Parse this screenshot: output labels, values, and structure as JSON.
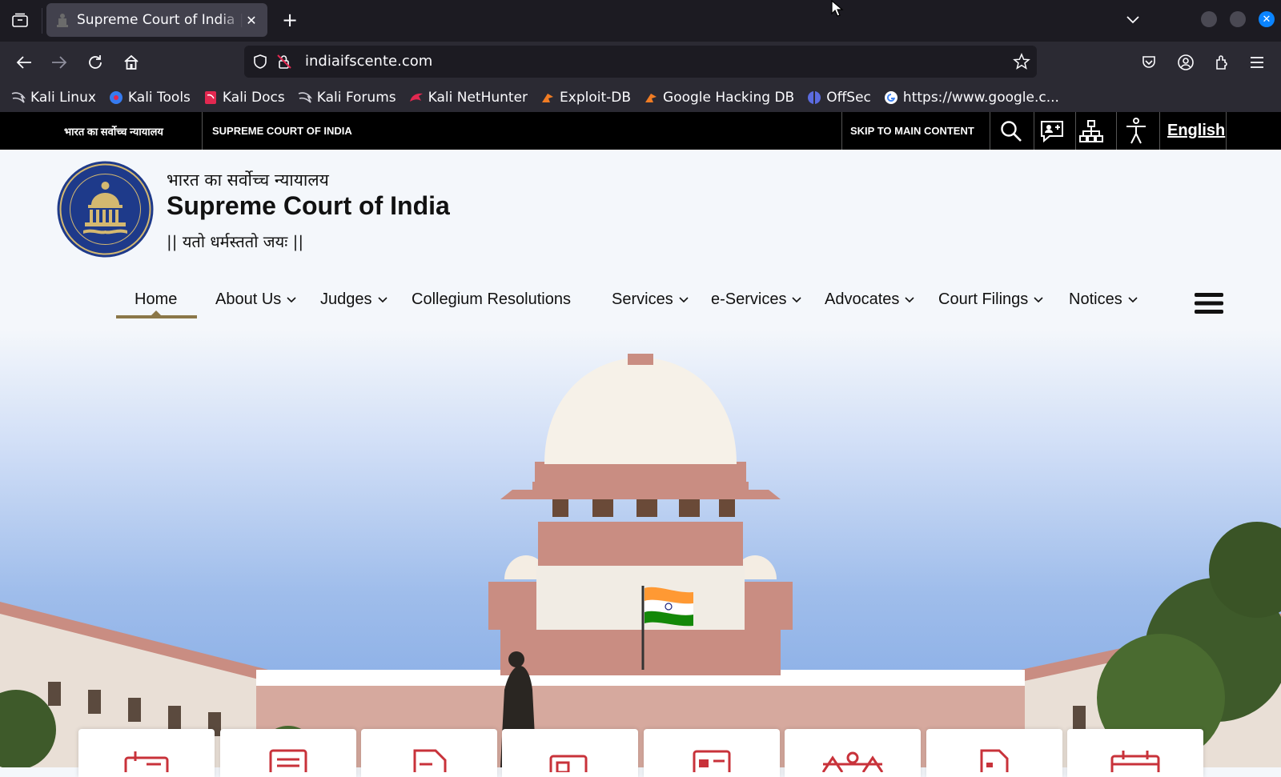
{
  "browser": {
    "tab_title": "Supreme Court of India | I",
    "url": "indiaifscente.com",
    "bookmarks": [
      {
        "label": "Kali Linux",
        "icon": "kali-dragon-icon"
      },
      {
        "label": "Kali Tools",
        "icon": "kali-tools-icon"
      },
      {
        "label": "Kali Docs",
        "icon": "kali-docs-icon"
      },
      {
        "label": "Kali Forums",
        "icon": "kali-dragon-icon"
      },
      {
        "label": "Kali NetHunter",
        "icon": "nethunter-icon"
      },
      {
        "label": "Exploit-DB",
        "icon": "exploit-db-icon"
      },
      {
        "label": "Google Hacking DB",
        "icon": "ghdb-icon"
      },
      {
        "label": "OffSec",
        "icon": "offsec-icon"
      },
      {
        "label": "https://www.google.c...",
        "icon": "google-icon"
      }
    ]
  },
  "topstrip": {
    "hindi_name": "भारत का सर्वोच्च न्यायालय",
    "english_name": "SUPREME COURT OF INDIA",
    "skip_link": "SKIP TO MAIN CONTENT",
    "language": "English"
  },
  "header": {
    "hindi_title": "भारत का सर्वोच्च न्यायालय",
    "title": "Supreme Court of India",
    "motto": "|| यतो धर्मस्ततो जयः ||"
  },
  "nav": {
    "items": [
      {
        "label": "Home",
        "dropdown": false
      },
      {
        "label": "About Us",
        "dropdown": true
      },
      {
        "label": "Judges",
        "dropdown": true
      },
      {
        "label": "Collegium Resolutions",
        "dropdown": false
      },
      {
        "label": "Services",
        "dropdown": true
      },
      {
        "label": "e-Services",
        "dropdown": true
      },
      {
        "label": "Advocates",
        "dropdown": true
      },
      {
        "label": "Court Filings",
        "dropdown": true
      },
      {
        "label": "Notices",
        "dropdown": true
      }
    ]
  },
  "colors": {
    "accent_underline": "#8b7748",
    "card_icon": "#c8323a",
    "emblem_blue": "#1e3a8a"
  }
}
